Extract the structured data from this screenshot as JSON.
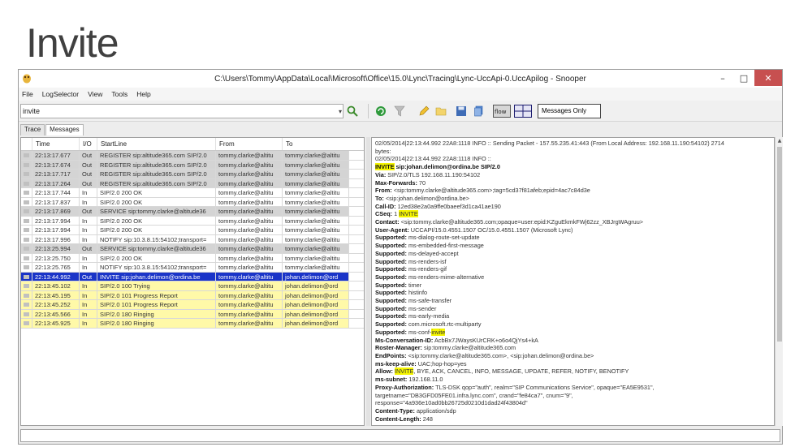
{
  "slide": {
    "title": "Invite"
  },
  "window": {
    "title": "C:\\Users\\Tommy\\AppData\\Local\\Microsoft\\Office\\15.0\\Lync\\Tracing\\Lync-UccApi-0.UccApilog - Snooper",
    "min": "–",
    "max": "□",
    "close": "✕"
  },
  "menu": [
    "File",
    "LogSelector",
    "View",
    "Tools",
    "Help"
  ],
  "toolbar": {
    "search_value": "invite",
    "dropdown": "▾",
    "messages_only": "Messages Only"
  },
  "tabs": [
    "Trace",
    "Messages"
  ],
  "grid": {
    "columns": [
      "Time",
      "I/O",
      "StartLine",
      "From",
      "To"
    ],
    "rows": [
      {
        "time": "22:13:17.677",
        "io": "Out",
        "start": "REGISTER sip:altitude365.com SIP/2.0",
        "from": "tommy.clarke@altitu",
        "to": "tommy.clarke@altitu",
        "style": "gray"
      },
      {
        "time": "22:13:17.674",
        "io": "Out",
        "start": "REGISTER sip:altitude365.com SIP/2.0",
        "from": "tommy.clarke@altitu",
        "to": "tommy.clarke@altitu",
        "style": "gray"
      },
      {
        "time": "22:13:17.717",
        "io": "Out",
        "start": "REGISTER sip:altitude365.com SIP/2.0",
        "from": "tommy.clarke@altitu",
        "to": "tommy.clarke@altitu",
        "style": "gray"
      },
      {
        "time": "22:13:17.264",
        "io": "Out",
        "start": "REGISTER sip:altitude365.com SIP/2.0",
        "from": "tommy.clarke@altitu",
        "to": "tommy.clarke@altitu",
        "style": "gray"
      },
      {
        "time": "22:13:17.744",
        "io": "In",
        "start": "SIP/2.0 200 OK",
        "from": "tommy.clarke@altitu",
        "to": "tommy.clarke@altitu",
        "style": "white"
      },
      {
        "time": "22:13:17.837",
        "io": "In",
        "start": "SIP/2.0 200 OK",
        "from": "tommy.clarke@altitu",
        "to": "tommy.clarke@altitu",
        "style": "white"
      },
      {
        "time": "22:13:17.869",
        "io": "Out",
        "start": "SERVICE sip:tommy.clarke@altitude36",
        "from": "tommy.clarke@altitu",
        "to": "tommy.clarke@altitu",
        "style": "gray"
      },
      {
        "time": "22:13:17.994",
        "io": "In",
        "start": "SIP/2.0 200 OK",
        "from": "tommy.clarke@altitu",
        "to": "tommy.clarke@altitu",
        "style": "white"
      },
      {
        "time": "22:13:17.994",
        "io": "In",
        "start": "SIP/2.0 200 OK",
        "from": "tommy.clarke@altitu",
        "to": "tommy.clarke@altitu",
        "style": "white"
      },
      {
        "time": "22:13:17.996",
        "io": "In",
        "start": "NOTIFY sip:10.3.8.15:54102;transport=",
        "from": "tommy.clarke@altitu",
        "to": "tommy.clarke@altitu",
        "style": "white"
      },
      {
        "time": "22:13:25.994",
        "io": "Out",
        "start": "SERVICE sip:tommy.clarke@altitude36",
        "from": "tommy.clarke@altitu",
        "to": "tommy.clarke@altitu",
        "style": "gray"
      },
      {
        "time": "22:13:25.750",
        "io": "In",
        "start": "SIP/2.0 200 OK",
        "from": "tommy.clarke@altitu",
        "to": "tommy.clarke@altitu",
        "style": "white"
      },
      {
        "time": "22:13:25.765",
        "io": "In",
        "start": "NOTIFY sip:10.3.8.15:54102;transport=",
        "from": "tommy.clarke@altitu",
        "to": "tommy.clarke@altitu",
        "style": "white"
      },
      {
        "time": "22:13:44.992",
        "io": "Out",
        "start": "INVITE sip:johan.delimon@ordina.be",
        "from": "tommy.clarke@altitu",
        "to": "johan.delimon@ord",
        "style": "selected"
      },
      {
        "time": "22:13:45.102",
        "io": "In",
        "start": "SIP/2.0 100 Trying",
        "from": "tommy.clarke@altitu",
        "to": "johan.delimon@ord",
        "style": "yellow"
      },
      {
        "time": "22:13:45.195",
        "io": "In",
        "start": "SIP/2.0 101 Progress Report",
        "from": "tommy.clarke@altitu",
        "to": "johan.delimon@ord",
        "style": "yellow"
      },
      {
        "time": "22:13:45.252",
        "io": "In",
        "start": "SIP/2.0 101 Progress Report",
        "from": "tommy.clarke@altitu",
        "to": "johan.delimon@ord",
        "style": "yellow"
      },
      {
        "time": "22:13:45.566",
        "io": "In",
        "start": "SIP/2.0 180 Ringing",
        "from": "tommy.clarke@altitu",
        "to": "johan.delimon@ord",
        "style": "yellow"
      },
      {
        "time": "22:13:45.925",
        "io": "In",
        "start": "SIP/2.0 180 Ringing",
        "from": "tommy.clarke@altitu",
        "to": "johan.delimon@ord",
        "style": "yellow"
      }
    ]
  },
  "detail": {
    "lines": [
      {
        "k": "",
        "v": "02/05/2014|22:13:44.992 22A8:1118 INFO :: Sending Packet - 157.55.235.41:443 (From Local Address: 192.168.11.190:54102) 2714"
      },
      {
        "k": "",
        "v": "bytes:"
      },
      {
        "k": "",
        "v": "02/05/2014|22:13:44.992 22A8:1118 INFO :: "
      },
      {
        "k": "INVITE",
        "v": " sip:johan.delimon@ordina.be SIP/2.0",
        "hlk": true,
        "boldv": true
      },
      {
        "k": "Via:",
        "v": " SIP/2.0/TLS 192.168.11.190:54102"
      },
      {
        "k": "Max-Forwards:",
        "v": " 70"
      },
      {
        "k": "From:",
        "v": " <sip:tommy.clarke@altitude365.com>;tag=5cd37f81afeb;epid=4ac7c84d3e"
      },
      {
        "k": "To:",
        "v": " <sip:johan.delimon@ordina.be>"
      },
      {
        "k": "Call-ID:",
        "v": " 12ed38e2a0a9ffe0baeef3d1ca41ae190"
      },
      {
        "k": "CSeq:",
        "v": " 1 ",
        "hl": "INVITE"
      },
      {
        "k": "Contact:",
        "v": " <sip:tommy.clarke@altitude365.com;opaque=user:epid:KZguEkmkFWj62zz_XBJrgWAgruu>"
      },
      {
        "k": "User-Agent:",
        "v": " UCCAPI/15.0.4551.1507 OC/15.0.4551.1507 (Microsoft Lync)"
      },
      {
        "k": "Supported:",
        "v": " ms-dialog-route-set-update"
      },
      {
        "k": "Supported:",
        "v": " ms-embedded-first-message"
      },
      {
        "k": "Supported:",
        "v": " ms-delayed-accept"
      },
      {
        "k": "Supported:",
        "v": " ms-renders-isf"
      },
      {
        "k": "Supported:",
        "v": " ms-renders-gif"
      },
      {
        "k": "Supported:",
        "v": " ms-renders-mime-alternative"
      },
      {
        "k": "Supported:",
        "v": " timer"
      },
      {
        "k": "Supported:",
        "v": " histinfo"
      },
      {
        "k": "Supported:",
        "v": " ms-safe-transfer"
      },
      {
        "k": "Supported:",
        "v": " ms-sender"
      },
      {
        "k": "Supported:",
        "v": " ms-early-media"
      },
      {
        "k": "Supported:",
        "v": " com.microsoft.rtc-multiparty"
      },
      {
        "k": "Supported:",
        "v": " ms-conf-",
        "hl": "invite"
      },
      {
        "k": "Ms-Conversation-ID:",
        "v": " AcbBx7JWaysKUrCRK+o6o4QjYs4+kA"
      },
      {
        "k": "Roster-Manager:",
        "v": " sip:tommy.clarke@altitude365.com"
      },
      {
        "k": "EndPoints:",
        "v": " <sip:tommy.clarke@altitude365.com>, <sip:johan.delimon@ordina.be>"
      },
      {
        "k": "ms-keep-alive:",
        "v": " UAC;hop-hop=yes"
      },
      {
        "k": "Allow:",
        "v": " ",
        "hl": "INVITE",
        "tail": ", BYE, ACK, CANCEL, INFO, MESSAGE, UPDATE, REFER, NOTIFY, BENOTIFY"
      },
      {
        "k": "ms-subnet:",
        "v": " 192.168.11.0"
      },
      {
        "k": "Proxy-Authorization:",
        "v": " TLS-DSK qop=\"auth\", realm=\"SIP Communications Service\", opaque=\"EA5E9531\","
      },
      {
        "k": "",
        "v": "targetname=\"DB3GFD05FE01.infra.lync.com\", crand=\"fe84ca7\", cnum=\"9\","
      },
      {
        "k": "",
        "v": "response=\"4a936e10ad0bb26725d0210d1dad24f43804d\""
      },
      {
        "k": "Content-Type:",
        "v": " application/sdp"
      },
      {
        "k": "Content-Length:",
        "v": " 248"
      }
    ]
  },
  "colors": {
    "selected_row": "#1a34c8",
    "highlight_row": "#fff9a8",
    "gray_row": "#d4d4d4",
    "search_highlight": "#f5f500",
    "close_button": "#c75050"
  },
  "icons": [
    "app-icon",
    "search-icon",
    "refresh-icon",
    "filter-icon",
    "pencil-icon",
    "folder-icon",
    "save-icon",
    "copy-icon",
    "flow-icon",
    "split-view-icon"
  ]
}
